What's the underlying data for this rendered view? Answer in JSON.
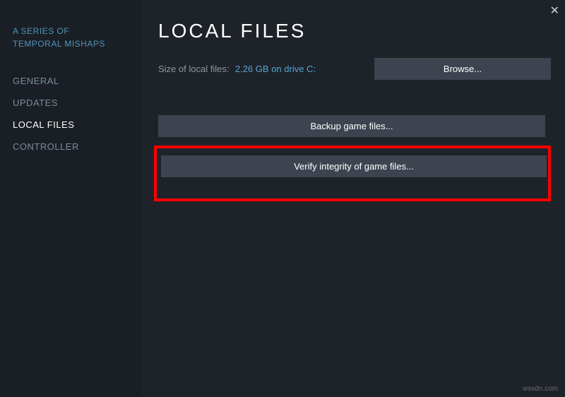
{
  "close_label": "✕",
  "game_title": "A SERIES OF TEMPORAL MISHAPS",
  "nav": {
    "general": "GENERAL",
    "updates": "UPDATES",
    "local_files": "LOCAL FILES",
    "controller": "CONTROLLER"
  },
  "page_title": "LOCAL FILES",
  "size_label": "Size of local files:",
  "size_value": "2.26 GB on drive C:",
  "browse_button": "Browse...",
  "backup_button": "Backup game files...",
  "verify_button": "Verify integrity of game files...",
  "watermark": "wsxdn.com"
}
